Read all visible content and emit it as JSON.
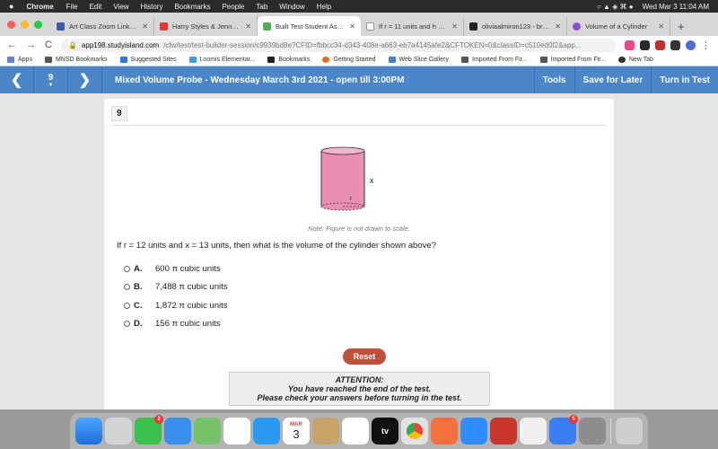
{
  "menubar": {
    "apple": "",
    "app": "Chrome",
    "items": [
      "File",
      "Edit",
      "View",
      "History",
      "Bookmarks",
      "People",
      "Tab",
      "Window",
      "Help"
    ],
    "datetime": "Wed Mar 3  11:04 AM"
  },
  "tabs": [
    {
      "title": "Art Class Zoom Link | Sch",
      "color": "#3b5da8"
    },
    {
      "title": "Harry Styles & Jenny Lew",
      "color": "#d93b3b"
    },
    {
      "title": "Built Test Student Assign",
      "color": "#4caf50"
    },
    {
      "title": "If r = 11 units and h = 7 un",
      "color": "#ffffff"
    },
    {
      "title": "oliviaalmiron123 - brainly",
      "color": "#222222"
    },
    {
      "title": "Volume of a Cylinder",
      "color": "#8a4fd0"
    }
  ],
  "address": {
    "domain": "app198.studyisland.com",
    "path": "/cfw/test/test-builder-session/c9939bd8e?CFID=fbbcc34-d343-408e-a663-eb7a4145afe2&CFTOKEN=0&classID=c510ed0f2&app..."
  },
  "bookmarks": [
    "Apps",
    "MNSD Bookmarks",
    "Suggested Sites",
    "Loomis Elementar...",
    "Bookmarks",
    "Getting Started",
    "Web Slice Gallery",
    "Imported From Fir...",
    "Imported From Fir...",
    "New Tab"
  ],
  "toolbar": {
    "question_number": "9",
    "title": "Mixed Volume Probe - Wednesday March 3rd 2021 - open till 3:00PM",
    "tools": "Tools",
    "save": "Save for Later",
    "turn_in": "Turn in Test"
  },
  "question": {
    "number": "9",
    "figure_label": "x",
    "figure_dash_label": "r",
    "note": "Note: Figure is not drawn to scale.",
    "text": "If r = 12 units and x = 13 units, then what is the volume of the cylinder shown above?",
    "options": [
      {
        "letter": "A.",
        "value": "600 π  cubic units"
      },
      {
        "letter": "B.",
        "value": "7,488 π  cubic units"
      },
      {
        "letter": "C.",
        "value": "1,872 π  cubic units"
      },
      {
        "letter": "D.",
        "value": "156 π  cubic units"
      }
    ],
    "reset": "Reset",
    "attention_title": "ATTENTION:",
    "attention_line1": "You have reached the end of the test.",
    "attention_line2": "Please check your answers before turning in the test."
  },
  "dock": {
    "calendar_month": "MAR",
    "calendar_day": "3",
    "tv_label": "tv",
    "badge_messages": "2",
    "badge_other": "5"
  },
  "colors": {
    "toolbar_blue": "#4a86c8",
    "cylinder_fill": "#e98fb4",
    "reset_red": "#c0503b"
  }
}
